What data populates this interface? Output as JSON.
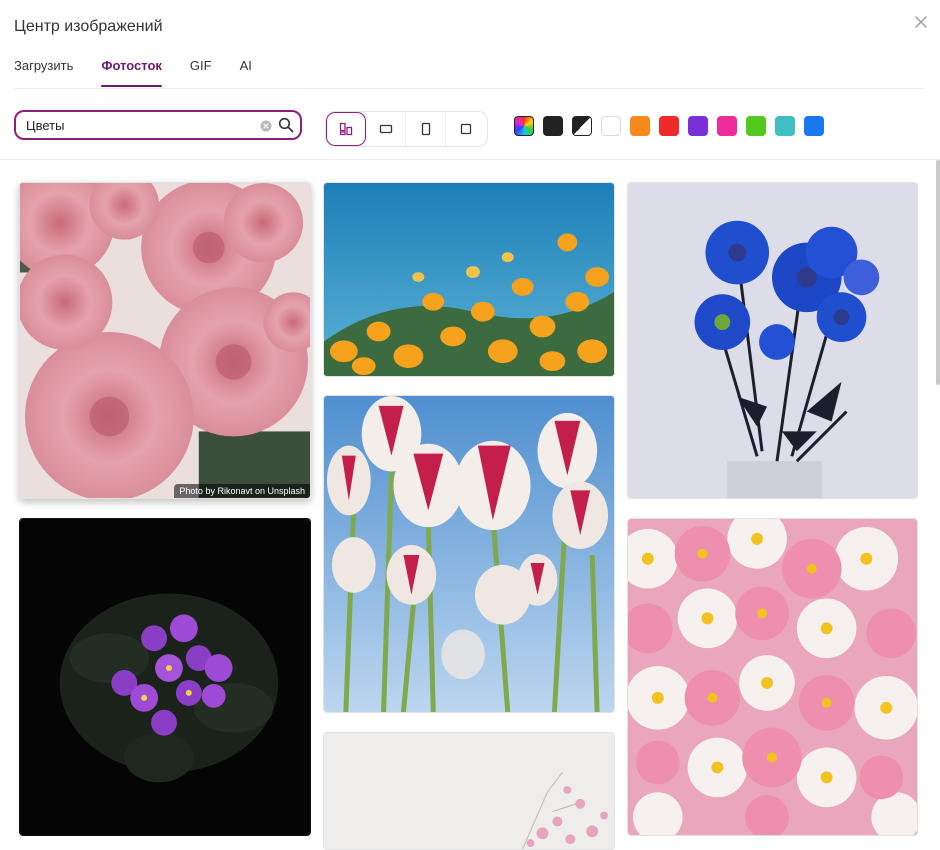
{
  "dialog": {
    "title": "Центр изображений"
  },
  "tabs": [
    {
      "label": "Загрузить",
      "active": false
    },
    {
      "label": "Фотосток",
      "active": true
    },
    {
      "label": "GIF",
      "active": false
    },
    {
      "label": "AI",
      "active": false
    }
  ],
  "search": {
    "value": "Цветы",
    "placeholder": ""
  },
  "orientation_filters": [
    {
      "name": "all-orientations",
      "icon": "masonry-icon",
      "active": true
    },
    {
      "name": "landscape",
      "icon": "landscape-icon",
      "active": false
    },
    {
      "name": "portrait",
      "icon": "portrait-icon",
      "active": false
    },
    {
      "name": "square",
      "icon": "square-icon",
      "active": false
    }
  ],
  "color_filters": [
    {
      "name": "multicolor",
      "color": "rainbow"
    },
    {
      "name": "black",
      "color": "#222222"
    },
    {
      "name": "black-and-white",
      "color": "bw"
    },
    {
      "name": "white",
      "color": "#ffffff"
    },
    {
      "name": "orange",
      "color": "#f7891a"
    },
    {
      "name": "red",
      "color": "#ee2a2a"
    },
    {
      "name": "purple",
      "color": "#7b2fd6"
    },
    {
      "name": "pink",
      "color": "#ee2d9b"
    },
    {
      "name": "green",
      "color": "#55c81f"
    },
    {
      "name": "teal",
      "color": "#3fbfbf"
    },
    {
      "name": "blue",
      "color": "#1a78ef"
    }
  ],
  "photos": [
    {
      "name": "pink-roses",
      "credit": "Photo by Rikonavt on Unsplash"
    },
    {
      "name": "orange-poppies"
    },
    {
      "name": "blue-daisies"
    },
    {
      "name": "purple-violets"
    },
    {
      "name": "red-white-tulips"
    },
    {
      "name": "pink-white-flowers"
    },
    {
      "name": "cosmos-flowers"
    }
  ]
}
